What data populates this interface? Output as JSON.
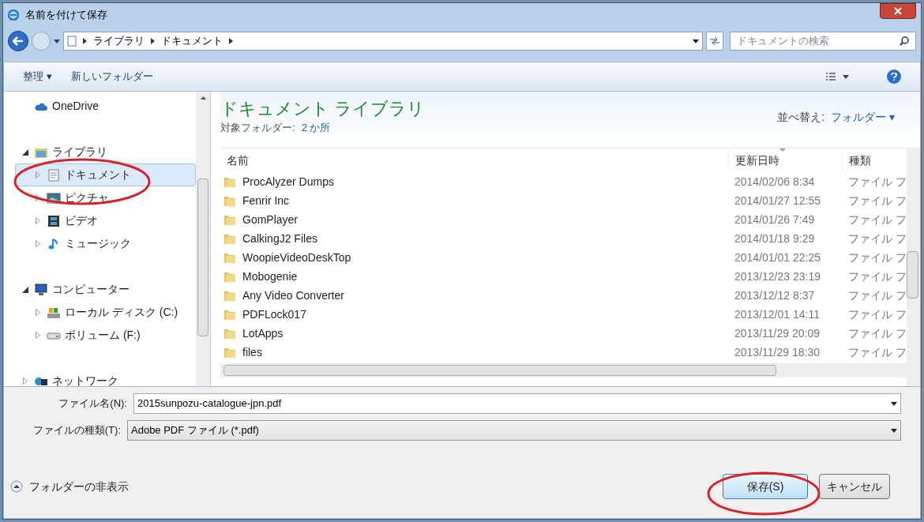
{
  "window": {
    "title": "名前を付けて保存"
  },
  "address": {
    "breadcrumb": [
      "ライブラリ",
      "ドキュメント"
    ]
  },
  "search": {
    "placeholder": "ドキュメントの検索"
  },
  "toolbar": {
    "organize": "整理 ▾",
    "new_folder": "新しいフォルダー"
  },
  "sidebar": {
    "items": [
      {
        "label": "OneDrive",
        "kind": "cloud",
        "selected": false
      },
      {
        "label": "ライブラリ",
        "kind": "library",
        "expanded": true,
        "selected": false,
        "children": [
          {
            "label": "ドキュメント",
            "kind": "document",
            "expanded": false,
            "selected": true
          },
          {
            "label": "ピクチャ",
            "kind": "picture",
            "expanded": false,
            "selected": false
          },
          {
            "label": "ビデオ",
            "kind": "video",
            "expanded": false,
            "selected": false
          },
          {
            "label": "ミュージック",
            "kind": "music",
            "expanded": false,
            "selected": false
          }
        ]
      },
      {
        "label": "コンピューター",
        "kind": "computer",
        "expanded": true,
        "selected": false,
        "children": [
          {
            "label": "ローカル ディスク (C:)",
            "kind": "disk",
            "expanded": false,
            "selected": false
          },
          {
            "label": "ボリューム (F:)",
            "kind": "drive",
            "expanded": false,
            "selected": false
          }
        ]
      },
      {
        "label": "ネットワーク",
        "kind": "network",
        "expanded": false,
        "selected": false
      }
    ]
  },
  "library": {
    "title": "ドキュメント ライブラリ",
    "target_label": "対象フォルダー:",
    "target_link": "2 か所",
    "sort_label": "並べ替え:",
    "sort_value": "フォルダー ▾"
  },
  "table": {
    "columns": [
      {
        "label": "名前",
        "sorted": false
      },
      {
        "label": "更新日時",
        "sorted": true
      },
      {
        "label": "種類",
        "sorted": false
      }
    ],
    "rows": [
      [
        "ProcAlyzer Dumps",
        "2014/02/06 8:34",
        "ファイル フ"
      ],
      [
        "Fenrir Inc",
        "2014/01/27 12:55",
        "ファイル フ"
      ],
      [
        "GomPlayer",
        "2014/01/26 7:49",
        "ファイル フ"
      ],
      [
        "CalkingJ2 Files",
        "2014/01/18 9:29",
        "ファイル フ"
      ],
      [
        "WoopieVideoDeskTop",
        "2014/01/01 22:25",
        "ファイル フ"
      ],
      [
        "Mobogenie",
        "2013/12/23 23:19",
        "ファイル フ"
      ],
      [
        "Any Video Converter",
        "2013/12/12 8:37",
        "ファイル フ"
      ],
      [
        "PDFLock017",
        "2013/12/01 14:11",
        "ファイル フ"
      ],
      [
        "LotApps",
        "2013/11/29 20:09",
        "ファイル フ"
      ],
      [
        "files",
        "2013/11/29 18:30",
        "ファイル フ"
      ]
    ]
  },
  "form": {
    "filename_label": "ファイル名(N):",
    "filename_value": "2015sunpozu-catalogue-jpn.pdf",
    "filetype_label": "ファイルの種類(T):",
    "filetype_value": "Adobe PDF ファイル (*.pdf)"
  },
  "footer": {
    "hide_folders": "フォルダーの非表示",
    "save": "保存(S)",
    "cancel": "キャンセル"
  }
}
